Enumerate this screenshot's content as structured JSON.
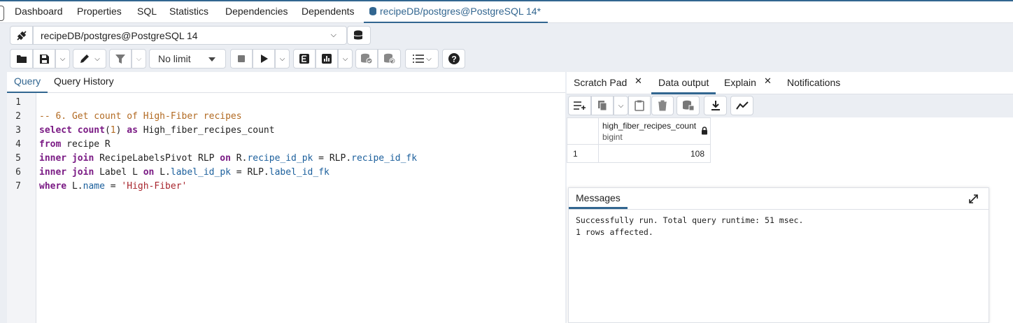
{
  "top_tabs": [
    "Dashboard",
    "Properties",
    "SQL",
    "Statistics",
    "Dependencies",
    "Dependents"
  ],
  "active_tab": "recipeDB/postgres@PostgreSQL 14*",
  "connection": "recipeDB/postgres@PostgreSQL 14",
  "limit": "No limit",
  "query_tabs": [
    "Query",
    "Query History"
  ],
  "editor": {
    "line_numbers": [
      "1",
      "2",
      "3",
      "4",
      "5",
      "6",
      "7"
    ],
    "lines": [
      [],
      [
        {
          "t": "-- 6. Get count of High-Fiber recipes",
          "c": "cm"
        }
      ],
      [
        {
          "t": "select",
          "c": "kw"
        },
        {
          "t": " ",
          "c": ""
        },
        {
          "t": "count",
          "c": "kw"
        },
        {
          "t": "(",
          "c": ""
        },
        {
          "t": "1",
          "c": "nm"
        },
        {
          "t": ") ",
          "c": ""
        },
        {
          "t": "as",
          "c": "kw"
        },
        {
          "t": " High_fiber_recipes_count",
          "c": ""
        }
      ],
      [
        {
          "t": "from",
          "c": "kw"
        },
        {
          "t": " recipe R",
          "c": ""
        }
      ],
      [
        {
          "t": "inner join",
          "c": "kw"
        },
        {
          "t": " RecipeLabelsPivot RLP ",
          "c": ""
        },
        {
          "t": "on",
          "c": "kw"
        },
        {
          "t": " R.",
          "c": ""
        },
        {
          "t": "recipe_id_pk",
          "c": "pr"
        },
        {
          "t": " = RLP.",
          "c": ""
        },
        {
          "t": "recipe_id_fk",
          "c": "pr"
        }
      ],
      [
        {
          "t": "inner join",
          "c": "kw"
        },
        {
          "t": " Label L ",
          "c": ""
        },
        {
          "t": "on",
          "c": "kw"
        },
        {
          "t": " L.",
          "c": ""
        },
        {
          "t": "label_id_pk",
          "c": "pr"
        },
        {
          "t": " = RLP.",
          "c": ""
        },
        {
          "t": "label_id_fk",
          "c": "pr"
        }
      ],
      [
        {
          "t": "where",
          "c": "kw"
        },
        {
          "t": " L.",
          "c": ""
        },
        {
          "t": "name",
          "c": "pr"
        },
        {
          "t": " = ",
          "c": ""
        },
        {
          "t": "'High-Fiber'",
          "c": "st"
        }
      ]
    ]
  },
  "result_tabs": [
    "Scratch Pad",
    "Data output",
    "Explain",
    "Notifications"
  ],
  "result_close": "✕",
  "grid": {
    "column_name": "high_fiber_recipes_count",
    "column_type": "bigint",
    "row_number": "1",
    "value": "108"
  },
  "messages": {
    "tab": "Messages",
    "line1": "Successfully run. Total query runtime: 51 msec.",
    "line2": "1 rows affected."
  },
  "colors": {
    "accent": "#326690",
    "keyword": "#7a1a84",
    "comment": "#b26a22",
    "property": "#1b5f9c",
    "string": "#a8262e"
  }
}
